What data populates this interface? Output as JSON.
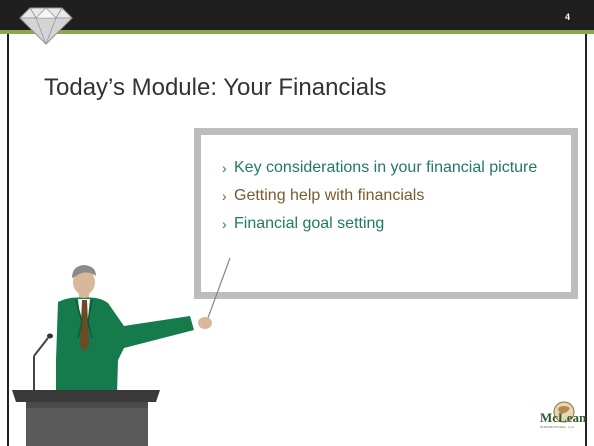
{
  "header": {
    "slide_number": "4",
    "logo_icon": "diamond-icon"
  },
  "title": "Today’s Module: Your Financials",
  "bullets": [
    {
      "text": "Key considerations in your financial picture",
      "color": "#1f7a68"
    },
    {
      "text": "Getting help with financials",
      "color": "#7a5a2e"
    },
    {
      "text": "Financial goal setting",
      "color": "#1f7a68"
    }
  ],
  "bullet_marker": "›",
  "illustration": "presenter-at-podium-with-pointer",
  "company_logo": {
    "icon": "globe-icon",
    "brand": "McLean",
    "tagline": "INTERNATIONAL, LLC"
  },
  "colors": {
    "topbar": "#1f1f1f",
    "accent_band": "#8aa84f",
    "teal": "#1f7a68",
    "brown": "#7a5a2e",
    "box_border": "#bdbdbd"
  }
}
